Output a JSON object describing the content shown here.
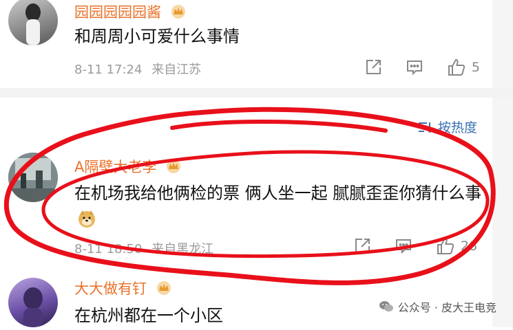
{
  "comments": [
    {
      "username": "园园园园园酱",
      "text": "和周周小可爱什么事情",
      "time": "8-11 17:24",
      "location": "来自江苏",
      "likes": "5",
      "emoji": ""
    },
    {
      "username": "A隔壁大老李",
      "text": "在机场我给他俩检的票 俩人坐一起 腻腻歪歪你猜什么事",
      "time": "8-11 18:50",
      "location": "来自黑龙江",
      "likes": "26",
      "emoji": "doge-emoji"
    },
    {
      "username": "大大做有钉",
      "text": "在杭州都在一个小区",
      "time": "",
      "location": "",
      "likes": "",
      "emoji": ""
    }
  ],
  "sort": {
    "label": "按热度",
    "icon": "sort-icon"
  },
  "watermark": {
    "text": "公众号 · 皮大王电竞",
    "icon": "wechat-icon"
  },
  "annotation": {
    "color": "#e8101a"
  },
  "colors": {
    "username": "#e8722a",
    "meta": "#9a9a9a",
    "link": "#3a6fb0"
  }
}
